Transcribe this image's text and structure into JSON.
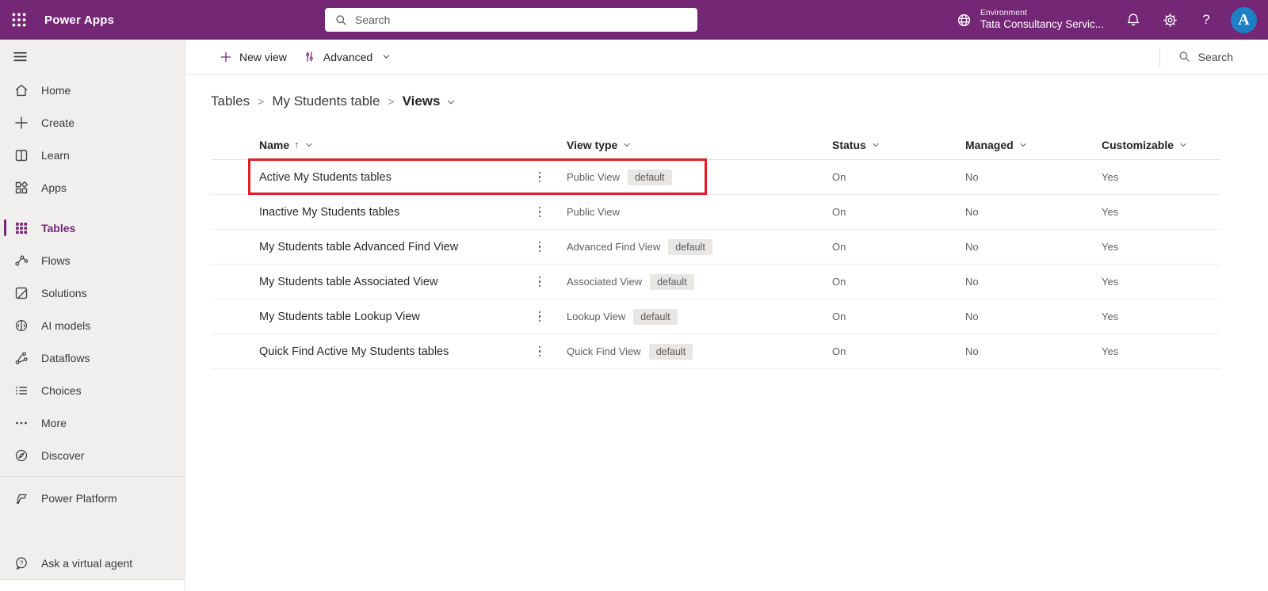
{
  "header": {
    "app_title": "Power Apps",
    "search_placeholder": "Search",
    "environment_label": "Environment",
    "environment_name": "Tata Consultancy Servic...",
    "avatar_letter": "A"
  },
  "icons": [
    "waffle-icon",
    "search-icon",
    "globe-icon",
    "bell-icon",
    "gear-icon",
    "help-icon",
    "hamburger-icon",
    "home-icon",
    "plus-icon",
    "book-icon",
    "apps-icon",
    "table-grid-icon",
    "flow-icon",
    "solutions-icon",
    "ai-icon",
    "dataflow-icon",
    "choices-icon",
    "more-icon",
    "discover-icon",
    "power-platform-icon",
    "chat-question-icon",
    "filter-icon",
    "chevron-down-icon",
    "more-options-icon"
  ],
  "colors": {
    "header_bg": "#742774",
    "accent": "#742774",
    "highlight_border": "#e11c22",
    "sidebar_bg": "#f0efee",
    "badge_bg": "#e9e7e5",
    "avatar_bg": "#1d7fc4"
  },
  "sidebar": {
    "items": [
      {
        "label": "Home",
        "icon": "home",
        "selected": false
      },
      {
        "label": "Create",
        "icon": "plus",
        "selected": false
      },
      {
        "label": "Learn",
        "icon": "book",
        "selected": false
      },
      {
        "label": "Apps",
        "icon": "apps",
        "selected": false
      },
      {
        "label": "Tables",
        "icon": "tablegrid",
        "selected": true
      },
      {
        "label": "Flows",
        "icon": "flow",
        "selected": false
      },
      {
        "label": "Solutions",
        "icon": "solutions",
        "selected": false
      },
      {
        "label": "AI models",
        "icon": "ai",
        "selected": false
      },
      {
        "label": "Dataflows",
        "icon": "dataflow",
        "selected": false
      },
      {
        "label": "Choices",
        "icon": "choices",
        "selected": false
      },
      {
        "label": "More",
        "icon": "more",
        "selected": false
      },
      {
        "label": "Discover",
        "icon": "discover",
        "selected": false
      }
    ],
    "power_platform_label": "Power Platform",
    "virtual_agent_label": "Ask a virtual agent"
  },
  "command_bar": {
    "new_view_label": "New view",
    "advanced_label": "Advanced",
    "search_label": "Search"
  },
  "breadcrumb": {
    "items": [
      "Tables",
      "My Students table",
      "Views"
    ]
  },
  "table": {
    "columns": [
      "Name",
      "View type",
      "Status",
      "Managed",
      "Customizable"
    ],
    "default_badge_label": "default",
    "rows": [
      {
        "name": "Active My Students tables",
        "view_type": "Public View",
        "default": true,
        "status": "On",
        "managed": "No",
        "customizable": "Yes",
        "highlighted": true
      },
      {
        "name": "Inactive My Students tables",
        "view_type": "Public View",
        "default": false,
        "status": "On",
        "managed": "No",
        "customizable": "Yes",
        "highlighted": false
      },
      {
        "name": "My Students table Advanced Find View",
        "view_type": "Advanced Find View",
        "default": true,
        "status": "On",
        "managed": "No",
        "customizable": "Yes",
        "highlighted": false
      },
      {
        "name": "My Students table Associated View",
        "view_type": "Associated View",
        "default": true,
        "status": "On",
        "managed": "No",
        "customizable": "Yes",
        "highlighted": false
      },
      {
        "name": "My Students table Lookup View",
        "view_type": "Lookup View",
        "default": true,
        "status": "On",
        "managed": "No",
        "customizable": "Yes",
        "highlighted": false
      },
      {
        "name": "Quick Find Active My Students tables",
        "view_type": "Quick Find View",
        "default": true,
        "status": "On",
        "managed": "No",
        "customizable": "Yes",
        "highlighted": false
      }
    ]
  }
}
